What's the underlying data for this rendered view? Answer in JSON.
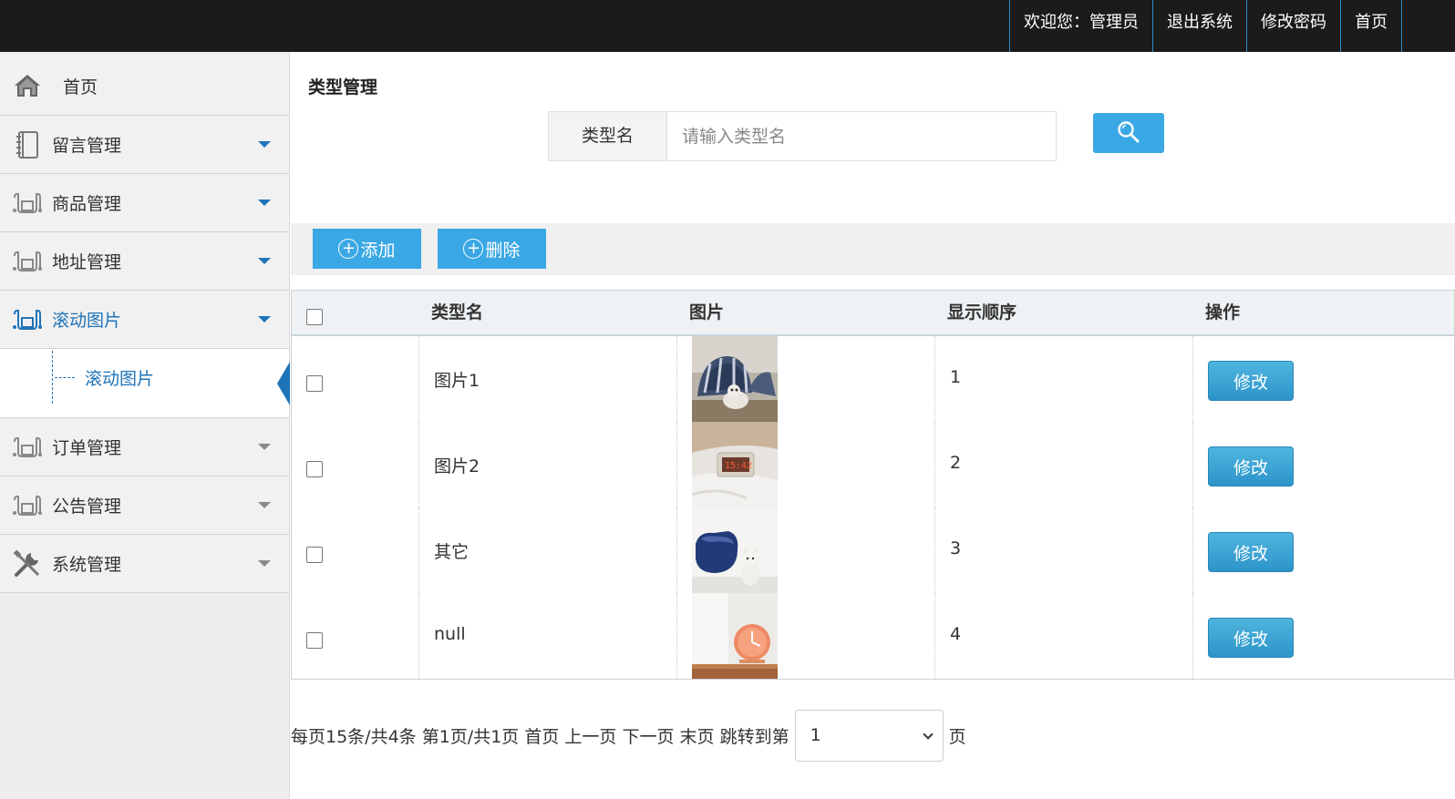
{
  "topnav": {
    "welcome": "欢迎您：管理员",
    "logout": "退出系统",
    "change_password": "修改密码",
    "home": "首页"
  },
  "sidebar": {
    "home": "首页",
    "items": [
      {
        "label": "留言管理",
        "icon": "notebook-icon"
      },
      {
        "label": "商品管理",
        "icon": "module-icon"
      },
      {
        "label": "地址管理",
        "icon": "module-icon"
      },
      {
        "label": "滚动图片",
        "icon": "module-icon",
        "active": true
      },
      {
        "label": "订单管理",
        "icon": "module-icon"
      },
      {
        "label": "公告管理",
        "icon": "module-icon"
      },
      {
        "label": "系统管理",
        "icon": "tools-icon"
      }
    ],
    "sub_item": "滚动图片"
  },
  "main": {
    "title": "类型管理",
    "search": {
      "label": "类型名",
      "placeholder": "请输入类型名"
    },
    "toolbar": {
      "add": "添加",
      "delete": "删除"
    },
    "table": {
      "headers": [
        "类型名",
        "图片",
        "显示顺序",
        "操作"
      ],
      "rows": [
        {
          "name": "图片1",
          "order": "1",
          "action": "修改",
          "image": "cat-in-striped-bed"
        },
        {
          "name": "图片2",
          "order": "2",
          "action": "修改",
          "image": "digital-clock-on-bed"
        },
        {
          "name": "其它",
          "order": "3",
          "action": "修改",
          "image": "cat-beside-blue-bed"
        },
        {
          "name": "null",
          "order": "4",
          "action": "修改",
          "image": "orange-wall-clock"
        }
      ]
    },
    "pager": {
      "summary": "每页15条/共4条 第1页/共1页",
      "first": "首页",
      "prev": "上一页",
      "next": "下一页",
      "last": "末页",
      "jump_to": "跳转到第",
      "page_value": "1",
      "page_suffix": "页"
    }
  },
  "colors": {
    "topbar": "#1b1b1b",
    "accent": "#3aa8e4",
    "active_text": "#1f73b7",
    "edit_button": "#2d94c9"
  }
}
